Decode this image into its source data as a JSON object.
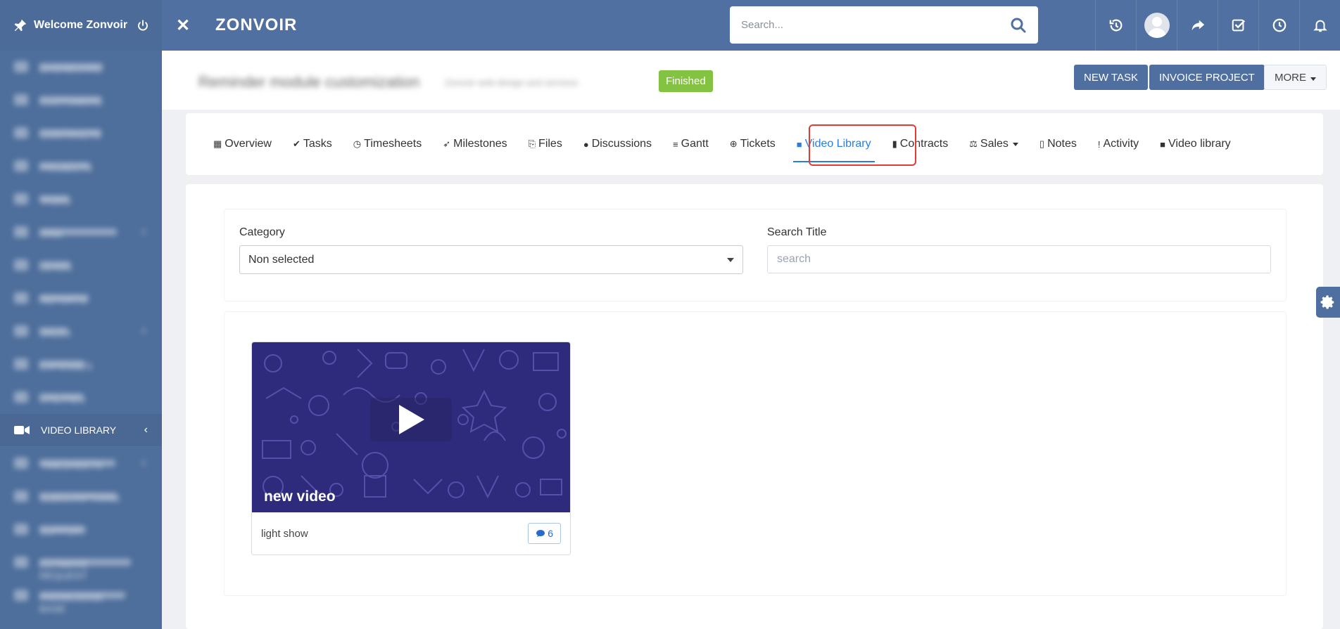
{
  "sidebar": {
    "welcome": "Welcome Zonvoir",
    "items_before": [
      {
        "label": "Dashboard"
      },
      {
        "label": "Customers"
      },
      {
        "label": "Contracts"
      },
      {
        "label": "Projects"
      },
      {
        "label": "Tasks"
      },
      {
        "label": "HRM"
      },
      {
        "label": "Leads"
      },
      {
        "label": "Reports"
      },
      {
        "label": "Sales"
      },
      {
        "label": "Expenses"
      },
      {
        "label": "Utilities"
      }
    ],
    "active_item": {
      "label": "VIDEO LIBRARY",
      "icon": "video-camera-icon",
      "chevron": "‹"
    },
    "items_after": [
      {
        "label": "Timesheets"
      },
      {
        "label": "Subscriptions"
      },
      {
        "label": "Support"
      },
      {
        "label": "Estimate Request"
      },
      {
        "label": "Knowledge Base"
      }
    ]
  },
  "topbar": {
    "close_icon": "✕",
    "logo": "ZONVOIR",
    "search_placeholder": "Search..."
  },
  "project": {
    "title": "Reminder module customization",
    "subtitle": "Zonvoir web design and services",
    "status": "Finished",
    "buttons": {
      "new_task": "NEW TASK",
      "invoice": "INVOICE PROJECT",
      "more": "MORE"
    }
  },
  "tabs": [
    {
      "label": "Overview",
      "icon": "▦"
    },
    {
      "label": "Tasks",
      "icon": "✔"
    },
    {
      "label": "Timesheets",
      "icon": "◷"
    },
    {
      "label": "Milestones",
      "icon": "➶"
    },
    {
      "label": "Files",
      "icon": "⎘"
    },
    {
      "label": "Discussions",
      "icon": "●"
    },
    {
      "label": "Gantt",
      "icon": "≡"
    },
    {
      "label": "Tickets",
      "icon": "⊕"
    },
    {
      "label": "Video Library",
      "icon": "■",
      "active": true
    },
    {
      "label": "Contracts",
      "icon": "▮"
    },
    {
      "label": "Sales",
      "icon": "⚖"
    },
    {
      "label": "Notes",
      "icon": "▯"
    },
    {
      "label": "Activity",
      "icon": "!"
    },
    {
      "label": "Video library",
      "icon": "■"
    }
  ],
  "filters": {
    "category_label": "Category",
    "category_value": "Non selected",
    "search_label": "Search Title",
    "search_placeholder": "search"
  },
  "videos": [
    {
      "thumb_title": "new video",
      "title": "light show",
      "comments": "6"
    }
  ],
  "colors": {
    "sidebar": "#4e6e9b",
    "topbar": "#4f70a0",
    "accent": "#2a7ee0",
    "finished": "#84c341",
    "thumbnail": "#2e2a7c"
  }
}
